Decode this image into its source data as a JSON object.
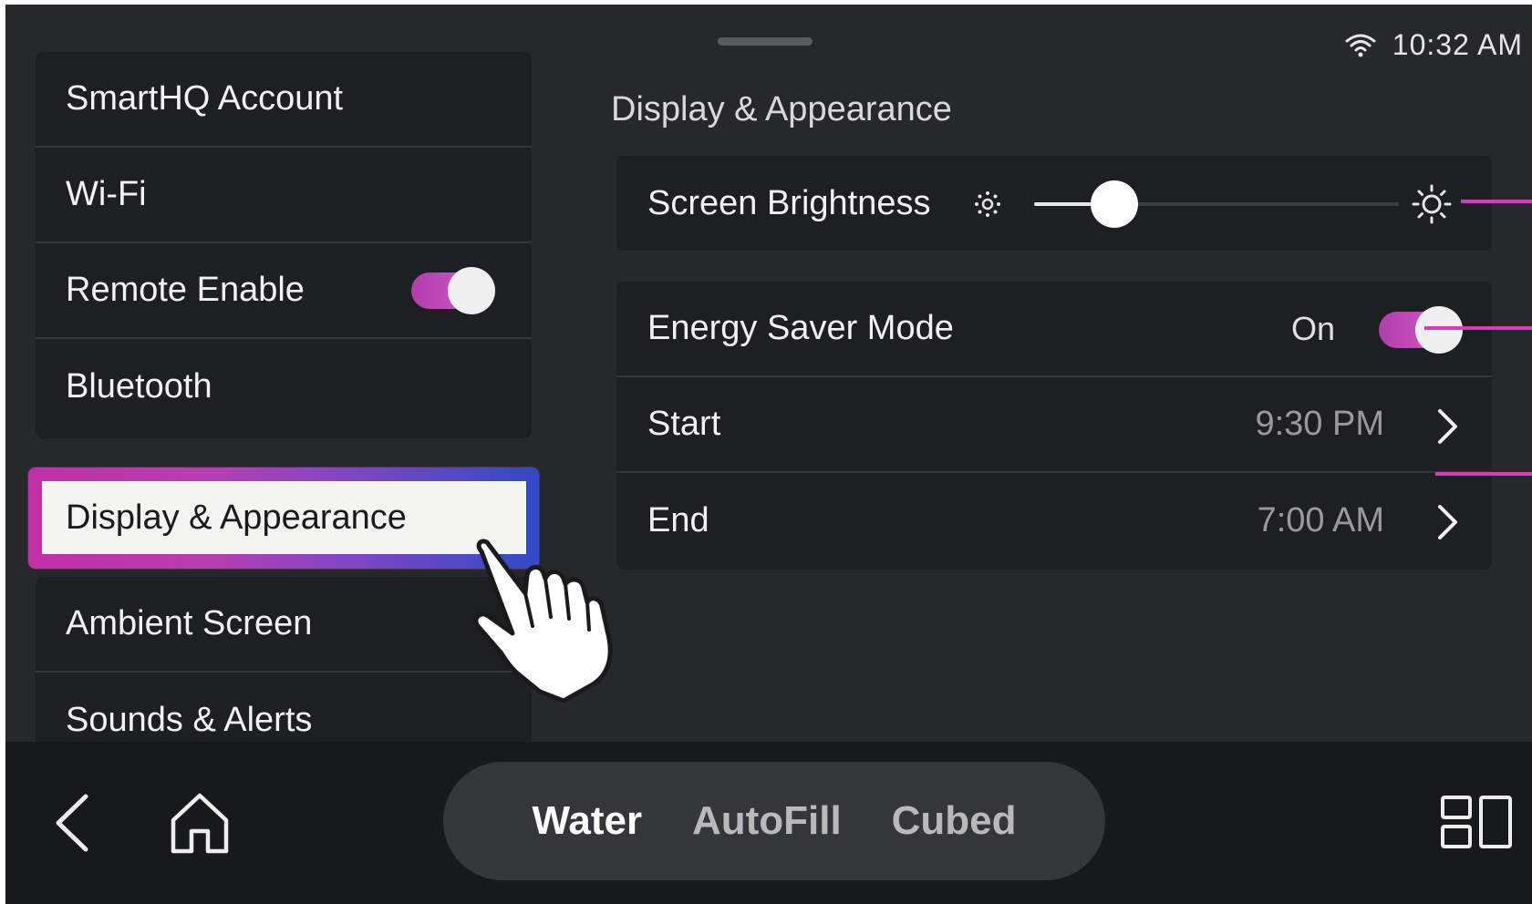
{
  "status": {
    "time": "10:32 AM",
    "wifi_icon": "wifi-icon"
  },
  "sidebar": {
    "items": [
      {
        "label": "SmartHQ Account"
      },
      {
        "label": "Wi-Fi"
      },
      {
        "label": "Remote Enable",
        "toggle": "on"
      },
      {
        "label": "Bluetooth"
      },
      {
        "label": "Display & Appearance",
        "selected": true
      },
      {
        "label": "Ambient Screen"
      },
      {
        "label": "Sounds & Alerts"
      }
    ]
  },
  "main": {
    "title": "Display & Appearance",
    "brightness": {
      "label": "Screen Brightness",
      "level": 0.22
    },
    "energy_saver": {
      "label": "Energy Saver Mode",
      "state": "On"
    },
    "start": {
      "label": "Start",
      "value": "9:30 PM"
    },
    "end": {
      "label": "End",
      "value": "7:00 AM"
    }
  },
  "bottom_nav": {
    "tabs": [
      {
        "label": "Water",
        "active": true
      },
      {
        "label": "AutoFill",
        "active": false
      },
      {
        "label": "Cubed",
        "active": false
      }
    ]
  },
  "colors": {
    "accent": "#d63dbd",
    "toggle_on": "#c44ab8",
    "selection_gradient_end": "#2f4bc4"
  }
}
